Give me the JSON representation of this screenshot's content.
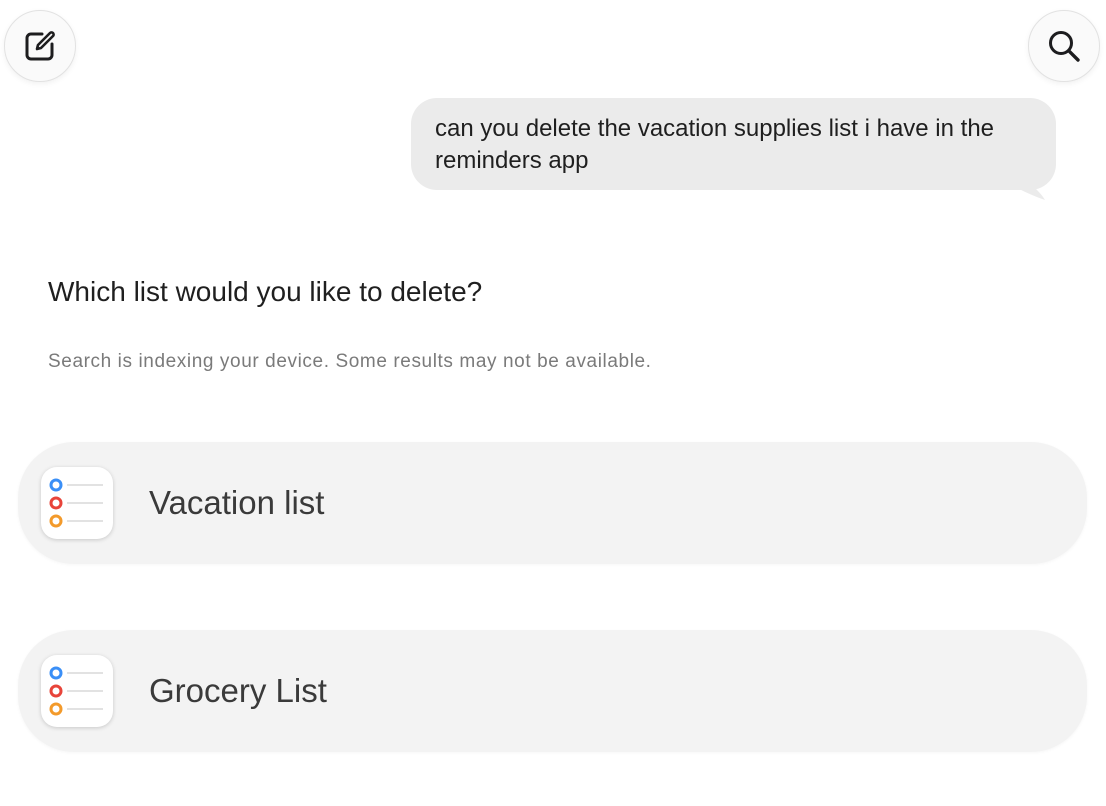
{
  "toolbar": {
    "compose_icon": "compose-icon",
    "search_icon": "search-icon"
  },
  "conversation": {
    "user_message": "can you delete the vacation supplies list i have in the reminders app",
    "assistant_question": "Which list would you like to delete?",
    "indexing_notice": "Search is indexing your device. Some results may not be available."
  },
  "lists": [
    {
      "label": "Vacation list",
      "icon": "reminders-app-icon"
    },
    {
      "label": "Grocery List",
      "icon": "reminders-app-icon"
    }
  ],
  "colors": {
    "bubble": "#ebebeb",
    "card": "#f3f3f3",
    "reminder_blue": "#3a8ff7",
    "reminder_red": "#e8443a",
    "reminder_orange": "#f39a2b"
  }
}
